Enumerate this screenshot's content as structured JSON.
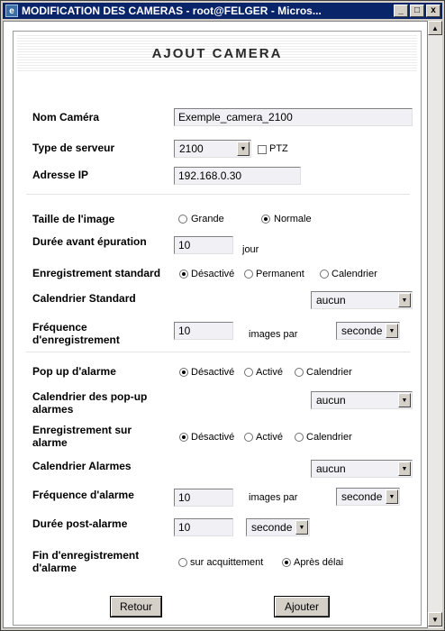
{
  "window": {
    "title_prefix": "MODIFICATION DES CAMERAS - ",
    "title_user": "root@FELGER",
    "title_suffix": " - Micros...",
    "minimize": "_",
    "maximize": "□",
    "close": "x"
  },
  "form": {
    "heading": "AJOUT CAMERA",
    "nom_camera": {
      "label": "Nom Caméra",
      "value": "Exemple_camera_2100"
    },
    "type_serveur": {
      "label": "Type de serveur",
      "value": "2100",
      "ptz_label": "PTZ",
      "ptz_checked": false
    },
    "adresse_ip": {
      "label": "Adresse IP",
      "value": "192.168.0.30"
    },
    "taille_image": {
      "label": "Taille de l'image",
      "options": [
        "Grande",
        "Normale"
      ],
      "selected": "Normale"
    },
    "duree_epuration": {
      "label": "Durée avant épuration",
      "value": "10",
      "unit": "jour"
    },
    "enregistrement_standard": {
      "label": "Enregistrement standard",
      "options": [
        "Désactivé",
        "Permanent",
        "Calendrier"
      ],
      "selected": "Désactivé"
    },
    "calendrier_standard": {
      "label": "Calendrier Standard",
      "value": "aucun"
    },
    "frequence_enregistrement": {
      "label_line1": "Fréquence",
      "label_line2": "d'enregistrement",
      "value": "10",
      "unit": "images par",
      "period": "seconde"
    },
    "popup_alarme": {
      "label": "Pop up d'alarme",
      "options": [
        "Désactivé",
        "Activé",
        "Calendrier"
      ],
      "selected": "Désactivé"
    },
    "calendrier_popup": {
      "label_line1": "Calendrier des pop-up",
      "label_line2": "alarmes",
      "value": "aucun"
    },
    "enregistrement_alarme": {
      "label_line1": "Enregistrement sur",
      "label_line2": "alarme",
      "options": [
        "Désactivé",
        "Activé",
        "Calendrier"
      ],
      "selected": "Désactivé"
    },
    "calendrier_alarmes": {
      "label": "Calendrier Alarmes",
      "value": "aucun"
    },
    "frequence_alarme": {
      "label": "Fréquence d'alarme",
      "value": "10",
      "unit": "images par",
      "period": "seconde"
    },
    "duree_post_alarme": {
      "label": "Durée post-alarme",
      "value": "10",
      "period": "seconde"
    },
    "fin_enregistrement": {
      "label_line1": "Fin d'enregistrement",
      "label_line2": "d'alarme",
      "options": [
        "sur acquittement",
        "Après délai"
      ],
      "selected": "Après délai"
    },
    "buttons": {
      "retour": "Retour",
      "ajouter": "Ajouter"
    }
  },
  "icons": {
    "app": "window-icon",
    "scroll_up": "scroll-up-icon",
    "scroll_down": "scroll-down-icon",
    "dropdown": "chevron-down-icon"
  }
}
